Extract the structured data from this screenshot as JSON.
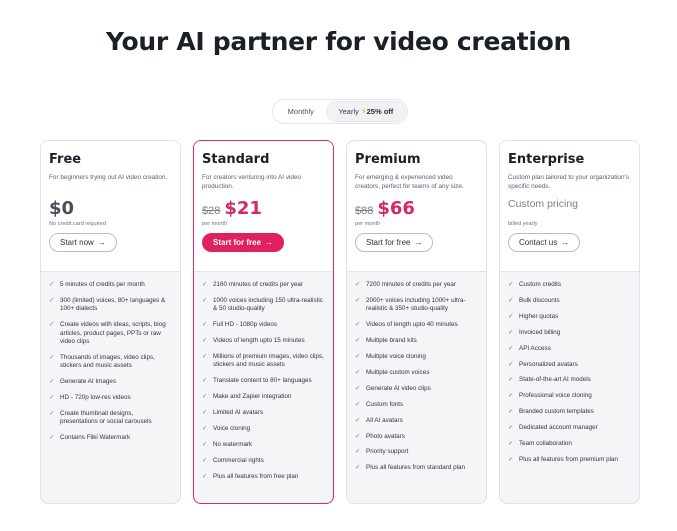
{
  "page": {
    "title": "Your AI partner for video creation"
  },
  "billing_toggle": {
    "monthly_label": "Monthly",
    "yearly_label": "Yearly",
    "discount_label": "25% off",
    "selected": "Yearly"
  },
  "accent_color": "#e0215f",
  "plans": [
    {
      "name": "Free",
      "description": "For beginners trying out AI video creation.",
      "price": "$0",
      "old_price": "",
      "price_note": "No credit card required",
      "button_label": "Start now",
      "features": [
        "5 minutes of credits per month",
        "300 (limited) voices, 80+ languages & 100+ dialects",
        "Create videos with ideas, scripts, blog articles, product pages, PPTs or raw video clips",
        "Thousands of images, video clips, stickers and music assets",
        "Generate AI Images",
        "HD - 720p low-res videos",
        "Create thumbnail designs, presentations or social carousels",
        "Contains Fliki Watermark"
      ]
    },
    {
      "name": "Standard",
      "description": "For creators venturing into AI video production.",
      "price": "$21",
      "old_price": "$28",
      "price_note": "per month",
      "button_label": "Start for free",
      "features": [
        "2160 minutes of credits per year",
        "1000 voices including 150 ultra-realistic & 50 studio-quality",
        "Full HD - 1080p videos",
        "Videos of length upto 15 minutes",
        "Millions of premium images, video clips, stickers and music assets",
        "Translate content to 80+ languages",
        "Make and Zapier integration",
        "Limited AI avatars",
        "Voice cloning",
        "No watermark",
        "Commercial rights",
        "Plus all features from free plan"
      ]
    },
    {
      "name": "Premium",
      "description": "For emerging & experienced video creators, perfect for teams of any size.",
      "price": "$66",
      "old_price": "$88",
      "price_note": "per month",
      "button_label": "Start for free",
      "features": [
        "7200 minutes of credits per year",
        "2000+ voices including 1000+ ultra-realistic & 350+ studio-quality",
        "Videos of length upto 40 minutes",
        "Multiple brand kits",
        "Multiple voice cloning",
        "Multiple custom voices",
        "Generate AI video clips",
        "Custom fonts",
        "All AI avatars",
        "Photo avatars",
        "Priority support",
        "Plus all features from standard plan"
      ]
    },
    {
      "name": "Enterprise",
      "description": "Custom plan tailored to your organization's specific needs.",
      "price": "Custom pricing",
      "old_price": "",
      "price_note": "billed yearly",
      "button_label": "Contact us",
      "features": [
        "Custom credits",
        "Bulk discounts",
        "Higher quotas",
        "Invoiced billing",
        "API Access",
        "Personalized avatars",
        "State-of-the-art AI models",
        "Professional voice cloning",
        "Branded custom templates",
        "Dedicated account manager",
        "Team collaboration",
        "Plus all features from premium plan"
      ]
    }
  ]
}
